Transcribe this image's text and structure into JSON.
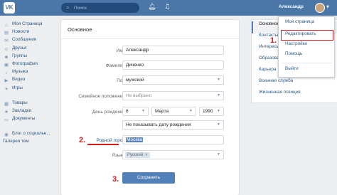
{
  "header": {
    "logo": "VK",
    "search_placeholder": "Поиск",
    "user_name": "Александр"
  },
  "sidebar": {
    "items": [
      {
        "label": "Моя Страница",
        "icon": "home-icon"
      },
      {
        "label": "Новости",
        "icon": "news-icon"
      },
      {
        "label": "Сообщения",
        "icon": "messages-icon"
      },
      {
        "label": "Друзья",
        "icon": "friends-icon"
      },
      {
        "label": "Группы",
        "icon": "groups-icon"
      },
      {
        "label": "Фотографии",
        "icon": "photos-icon"
      },
      {
        "label": "Музыка",
        "icon": "music-icon"
      },
      {
        "label": "Видео",
        "icon": "video-icon"
      },
      {
        "label": "Игры",
        "icon": "games-icon"
      }
    ],
    "items2": [
      {
        "label": "Товары",
        "icon": "goods-icon"
      },
      {
        "label": "Закладки",
        "icon": "bookmarks-icon"
      },
      {
        "label": "Документы",
        "icon": "documents-icon"
      }
    ],
    "items3": [
      {
        "label": "Блог о социальн...",
        "icon": "blog-icon"
      }
    ],
    "gallery": "Галерея тем"
  },
  "form": {
    "title": "Основное",
    "name_label": "Имя:",
    "name_value": "Александр",
    "surname_label": "Фамилия:",
    "surname_value": "Диченко",
    "gender_label": "Пол:",
    "gender_value": "мужской",
    "marital_label": "Семейное положение:",
    "marital_value": "Не выбрано",
    "birthday_label": "День рождения:",
    "birthday_day": "6",
    "birthday_month": "Марта",
    "birthday_year": "1990",
    "birthday_show": "Не показывать дату рождения",
    "hometown_label": "Родной город:",
    "hometown_value": "Москва",
    "languages_label": "Языки:",
    "language_chip": "Русский",
    "save_button": "Сохранить"
  },
  "settings_menu": {
    "items": [
      "Основное",
      "Контакты",
      "Интересы",
      "Образование",
      "Карьера",
      "Военная служба",
      "Жизненная позиция"
    ]
  },
  "profile_dropdown": {
    "items": [
      "Моя страница",
      "Редактировать",
      "Настройки",
      "Помощь",
      "Выйти"
    ]
  },
  "annotations": {
    "step1": "1.",
    "step2": "2.",
    "step3": "3.",
    "color": "#d51c1c"
  }
}
